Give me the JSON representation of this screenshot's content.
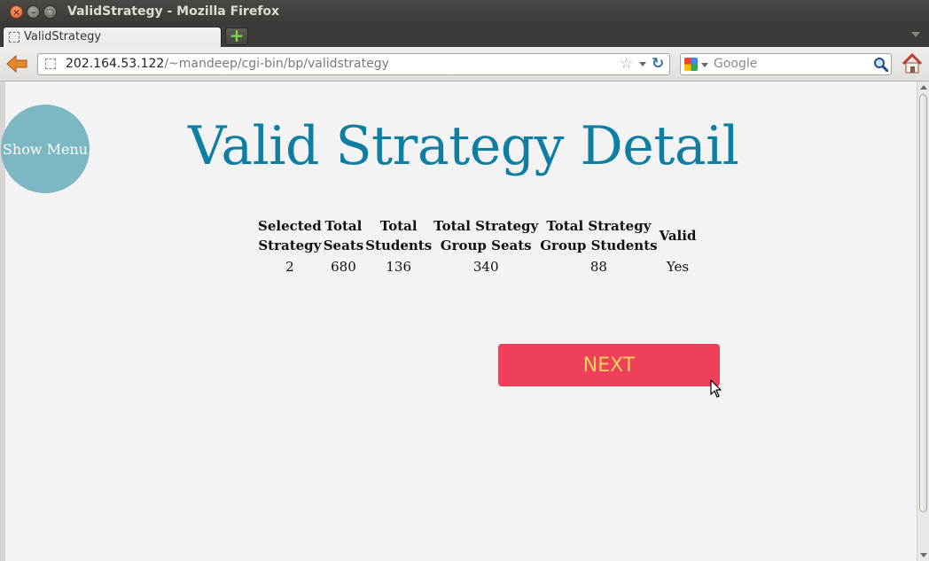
{
  "window": {
    "title": "ValidStrategy - Mozilla Firefox",
    "controls": {
      "close": "×",
      "minimize": "–",
      "maximize": "□"
    }
  },
  "tabs": [
    {
      "label": "ValidStrategy",
      "active": true
    }
  ],
  "newtab_label": "+",
  "navbar": {
    "url_host": "202.164.53.122",
    "url_path": "/~mandeep/cgi-bin/bp/validstrategy",
    "star_glyph": "☆",
    "reload_glyph": "↻",
    "search_placeholder": "Google"
  },
  "page": {
    "show_menu_label": "Show Menu",
    "title": "Valid Strategy Detail",
    "table": {
      "headers": [
        [
          "Selected",
          "Strategy"
        ],
        [
          "Total",
          "Seats"
        ],
        [
          "Total",
          "Students"
        ],
        [
          "Total Strategy",
          "Group Seats"
        ],
        [
          "Total Strategy",
          "Group Students"
        ],
        [
          "Valid"
        ]
      ],
      "rows": [
        [
          "2",
          "680",
          "136",
          "340",
          "88",
          "Yes"
        ]
      ]
    },
    "next_button_label": "NEXT"
  },
  "colors": {
    "title": "#0e7ea3",
    "menu_circle": "#7bb8c3",
    "next_bg": "#ef3f5a",
    "next_text": "#f2d45c",
    "page_bg": "#f3f3f3"
  },
  "icons": [
    "back-arrow-icon",
    "page-favicon-icon",
    "star-icon",
    "reload-icon",
    "google-icon",
    "magnifier-icon",
    "home-icon",
    "mouse-cursor-icon"
  ]
}
